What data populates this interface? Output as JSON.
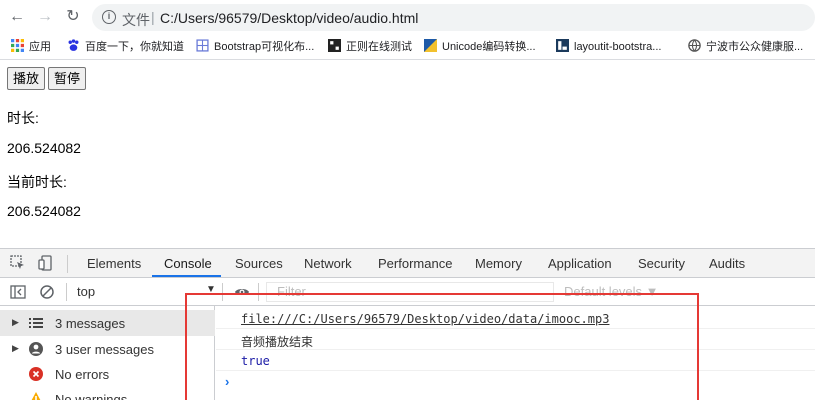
{
  "browser": {
    "address_label": "文件",
    "url": "C:/Users/96579/Desktop/video/audio.html",
    "bookmarks": [
      {
        "label": "应用",
        "icon": "apps-grid-icon"
      },
      {
        "label": "百度一下，你就知道",
        "icon": "baidu-paw-icon"
      },
      {
        "label": "Bootstrap可视化布...",
        "icon": "page-icon"
      },
      {
        "label": "正则在线测试",
        "icon": "regex-icon"
      },
      {
        "label": "Unicode编码转换...",
        "icon": "unicode-icon"
      },
      {
        "label": "layoutit-bootstra...",
        "icon": "layoutit-icon"
      },
      {
        "label": "宁波市公众健康服...",
        "icon": "globe-icon"
      }
    ]
  },
  "page": {
    "play_label": "播放",
    "pause_label": "暂停",
    "duration_label": "时长:",
    "duration_value": "206.524082",
    "current_label": "当前时长:",
    "current_value": "206.524082"
  },
  "devtools": {
    "tabs": [
      "Elements",
      "Console",
      "Sources",
      "Network",
      "Performance",
      "Memory",
      "Application",
      "Security",
      "Audits"
    ],
    "active_tab": "Console",
    "context": "top",
    "filter_placeholder": "Filter",
    "levels_label": "Default levels ▼",
    "sidebar": [
      {
        "label": "3 messages",
        "icon": "list-icon"
      },
      {
        "label": "3 user messages",
        "icon": "user-icon"
      },
      {
        "label": "No errors",
        "icon": "error-icon"
      },
      {
        "label": "No warnings",
        "icon": "warning-icon"
      }
    ],
    "messages": [
      "file:///C:/Users/96579/Desktop/video/data/imooc.mp3",
      "音频播放结束",
      "true"
    ],
    "prompt": "›"
  },
  "colors": {
    "accent": "#1a73e8",
    "highlight_box": "#e53935",
    "error": "#d93025",
    "warning": "#f9ab00"
  }
}
